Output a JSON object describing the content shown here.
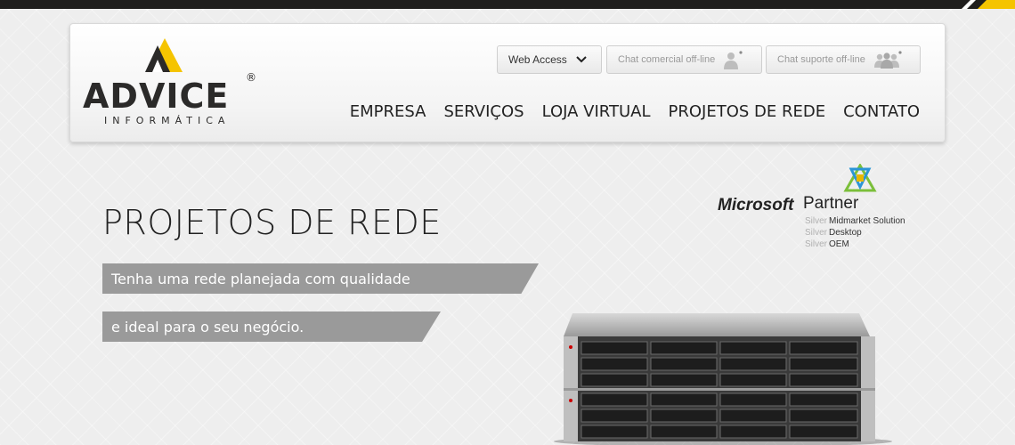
{
  "logo": {
    "name": "ADVICE",
    "registered": "®",
    "sub": "INFORMÁTICA",
    "colors": {
      "yellow": "#f5c400",
      "dark": "#2b2a29"
    }
  },
  "header": {
    "web_access": "Web Access",
    "chat_commercial": "Chat comercial off-line",
    "chat_support": "Chat suporte off-line"
  },
  "nav": {
    "items": [
      {
        "label": "EMPRESA"
      },
      {
        "label": "SERVIÇOS"
      },
      {
        "label": "LOJA VIRTUAL"
      },
      {
        "label": "PROJETOS DE REDE"
      },
      {
        "label": "CONTATO"
      }
    ]
  },
  "hero": {
    "title": "PROJETOS DE REDE",
    "band1": "Tenha uma rede planejada com qualidade",
    "band2": "e ideal para o seu negócio."
  },
  "partner": {
    "microsoft": "Microsoft",
    "partner": "Partner",
    "lines": [
      {
        "level": "Silver",
        "text": "Midmarket Solution"
      },
      {
        "level": "Silver",
        "text": "Desktop"
      },
      {
        "level": "Silver",
        "text": "OEM"
      }
    ]
  },
  "colors": {
    "topbar": "#1f1e1d",
    "accent": "#f5c400",
    "band": "#9a9a9a"
  }
}
